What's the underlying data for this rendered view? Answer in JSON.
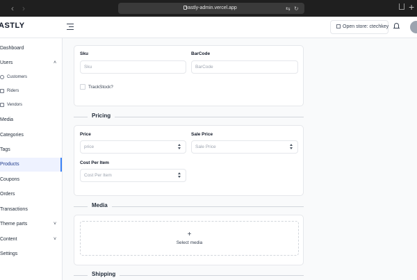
{
  "browser": {
    "url": "vastly-admin.vercel.app",
    "back_label": "‹",
    "forward_label": "›"
  },
  "header": {
    "logo": "ASTLY",
    "open_store_label": "Open store: ctechkey"
  },
  "sidebar": {
    "items": [
      {
        "label": "Dashboard"
      },
      {
        "label": "Users"
      },
      {
        "label": "Customers"
      },
      {
        "label": "Riders"
      },
      {
        "label": "Vendors"
      },
      {
        "label": "Media"
      },
      {
        "label": "Categories"
      },
      {
        "label": "Tags"
      },
      {
        "label": "Products"
      },
      {
        "label": "Coupons"
      },
      {
        "label": "Orders"
      },
      {
        "label": "Transactions"
      },
      {
        "label": "Theme parts"
      },
      {
        "label": "Content"
      },
      {
        "label": "Settings"
      }
    ],
    "active": "Products"
  },
  "inventory": {
    "sku_label": "Sku",
    "sku_placeholder": "Sku",
    "barcode_label": "BarCode",
    "barcode_placeholder": "BarCode",
    "track_stock_label": "TrackStock?"
  },
  "pricing": {
    "title": "Pricing",
    "price_label": "Price",
    "price_placeholder": "price",
    "sale_price_label": "Sale Price",
    "sale_price_placeholder": "Sale Price",
    "cost_label": "Cost Per Item",
    "cost_placeholder": "Cost Per Item"
  },
  "media": {
    "title": "Media",
    "select_label": "Select media"
  },
  "shipping": {
    "title": "Shipping"
  },
  "colors": {
    "accent": "#3b82f6",
    "active_bg": "#eef2ff"
  }
}
